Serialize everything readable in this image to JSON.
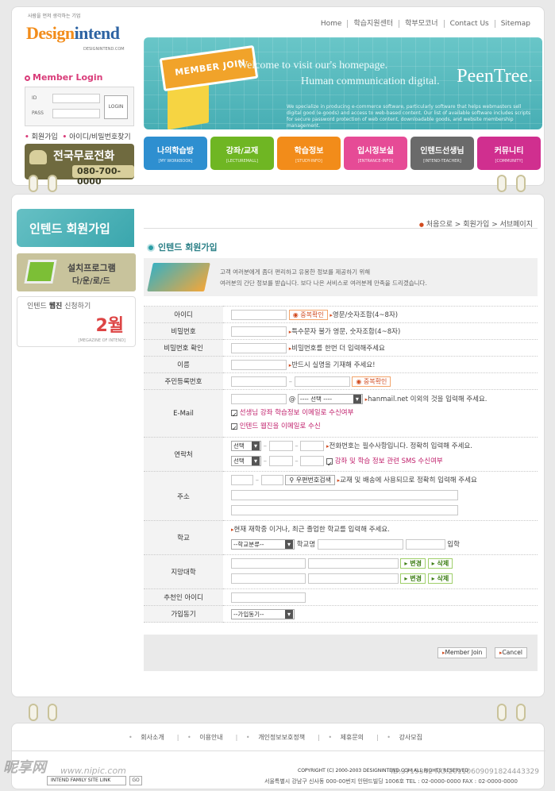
{
  "header": {
    "tagline": "사람을 먼저 생각하는 기업",
    "logo_a": "Design",
    "logo_b": "intend",
    "logo_url": "DESIGNINTEND.COM",
    "topnav": [
      "Home",
      "학습지원센터",
      "학부모코너",
      "Contact Us",
      "Sitemap"
    ]
  },
  "login": {
    "title": "Member Login",
    "id_label": "ID",
    "pass_label": "PASS",
    "button": "LOGIN",
    "join": "회원가입",
    "find": "아이디/비밀번호찾기",
    "phone_title": "전국무료전화",
    "phone_number": "080-700-0000"
  },
  "banner": {
    "sign": "MEMBER JOIN",
    "line1": "Welcome to visit our's homepage.",
    "line2": "Human communication digital.",
    "brand": "PeenTree.",
    "desc": "We specialize in producing e-commerce software, particularly software that helps webmasters sell digital good (e-goods) and access to web-based content. Our list of available software includes scripts for secure password protection of web content, downloadable goods, and website membership management."
  },
  "mainnav": [
    {
      "k": "나의학습방",
      "e": "[MY WORKBOOK]",
      "color": "#2e8fd0"
    },
    {
      "k": "강좌/교재",
      "e": "[LECTUREMALL]",
      "color": "#6fb623"
    },
    {
      "k": "학습정보",
      "e": "[STUDY-INFO]",
      "color": "#f28c1a"
    },
    {
      "k": "입시정보실",
      "e": "[ENTRANCE-INFO]",
      "color": "#e64b96"
    },
    {
      "k": "인텐드선생님",
      "e": "[INTEND-TEACHER]",
      "color": "#6a6a6a"
    },
    {
      "k": "커뮤니티",
      "e": "[COMMUNITY]",
      "color": "#d02f8f"
    }
  ],
  "sidebar": {
    "title": "인텐드 회원가입",
    "prog_a": "설치프로그램",
    "prog_b": "다/운/로/드",
    "mag_a_pre": "인텐드 ",
    "mag_a_bold": "웹진",
    "mag_a_post": " 신청하기",
    "mag_month": "2월",
    "mag_sub": "[MEGAZINE OF INTEND]"
  },
  "breadcrumb": "처음으로 > 회원가입 > 서브페이지",
  "page_title": "인텐드 회원가입",
  "intro": {
    "line1": "고객 여러분에게 좀더 편리하고 유용한 정보를 제공하기 위해",
    "line2": "여러분의 간단 정보를 받습니다. 보다 나은 서비스로 여러분께 만족을 드리겠습니다."
  },
  "form": {
    "id_label": "아이디",
    "dup_btn": "중복확인",
    "id_hint": "영문/숫자조합(4~8자)",
    "pw_label": "비밀번호",
    "pw_hint": "특수문자 불가 영문, 숫자조합(4~8자)",
    "pw2_label": "비밀번호 확인",
    "pw2_hint": "비밀번호를 한번 더 입력해주세요",
    "name_label": "이름",
    "name_hint": "반드시 실명을 기재해 주세요!",
    "ssn_label": "주민등록번호",
    "email_label": "E-Mail",
    "email_select": "---- 선택 ----",
    "email_hint": "hanmail.net 이외의 것을 입력해 주세요.",
    "email_chk1": "선생님 강좌 학습정보 이메일로 수신여부",
    "email_chk2": "인텐드 웹진을 이메일로 수신",
    "contact_label": "연락처",
    "contact_select": "선택",
    "contact_hint": "전화번호는 필수사항입니다. 정확히 입력해 주세요.",
    "sms_chk": "강좌 및 학습 정보 관련 SMS 수신여부",
    "addr_label": "주소",
    "zip_btn": "우편번호검색",
    "addr_hint": "교재 및 배송에 사용되므로 정확히 입력해 주세요",
    "school_label": "학교",
    "school_hint": "현재 재학중 이거나, 최근 졸업한 학교를 입력해 주세요.",
    "school_select": "--학교분류--",
    "school_name": "학교명",
    "school_year": "입학",
    "univ_label": "지망대학",
    "change_btn": "변경",
    "delete_btn": "삭제",
    "ref_label": "추천인 아이디",
    "motive_label": "가입동기",
    "motive_select": "--가입동기--",
    "join_btn": "Member Join",
    "cancel_btn": "Cancel"
  },
  "footer": {
    "links": [
      "회사소개",
      "이용안내",
      "개인정보보호정책",
      "제휴문의",
      "강사모집"
    ],
    "family": "INTEND FAMILY SITE LINK",
    "go": "GO",
    "copyright": "COPYRIGHT (C) 2000-2003 DESIGNINTEND.COM ALL RIGHTS RESERVED",
    "address": "서울특별시  강남구 신사동 000-00번지 인텐드빌딩 1006호  TEL : 02-0000-0000  FAX : 02-0000-0000"
  },
  "watermark": {
    "a": "昵享网",
    "b": "www.nipic.com",
    "id": "ID:3719342 NO:20110609091824443329"
  }
}
